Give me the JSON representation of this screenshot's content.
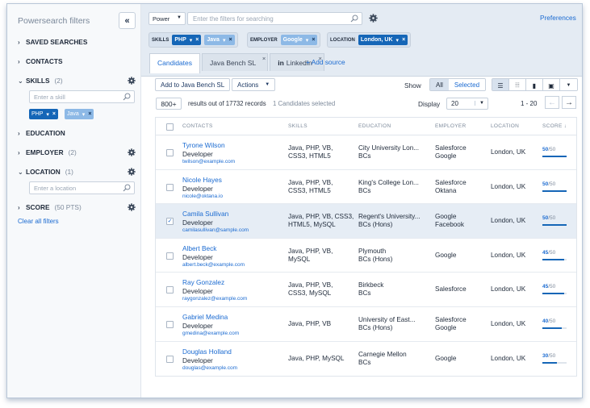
{
  "sidebar": {
    "title": "Powersearch filters",
    "collapse_icon": "«",
    "sections": [
      {
        "label": "SAVED SEARCHES",
        "count": ""
      },
      {
        "label": "CONTACTS",
        "count": ""
      },
      {
        "label": "SKILLS",
        "count": "(2)"
      },
      {
        "label": "EDUCATION",
        "count": ""
      },
      {
        "label": "EMPLOYER",
        "count": "(2)"
      },
      {
        "label": "LOCATION",
        "count": "(1)"
      },
      {
        "label": "SCORE",
        "count": "(50 PTS)"
      }
    ],
    "skill_placeholder": "Enter a skill",
    "skill_tags": [
      "PHP",
      "Java"
    ],
    "location_placeholder": "Enter a location",
    "clear_all": "Clear all filters"
  },
  "topbar": {
    "mode": "Power",
    "search_placeholder": "Enter the filters for searching",
    "preferences": "Preferences",
    "chips": [
      {
        "label": "SKILLS",
        "tags": [
          "PHP",
          "Java"
        ]
      },
      {
        "label": "EMPLOYER",
        "tags": [
          "Google"
        ]
      },
      {
        "label": "LOCATION",
        "tags": [
          "London, UK"
        ]
      }
    ],
    "tabs": [
      "Candidates",
      "Java Bench SL",
      "LinkedIn"
    ],
    "tab_close": "×",
    "add_source": "+ Add source"
  },
  "toolbar": {
    "add_to_bench": "Add to Java Bench SL",
    "actions": "Actions",
    "show_label": "Show",
    "show_all": "All",
    "show_selected": "Selected",
    "total_count": "800+",
    "results_text": "results out of 17732 records",
    "selected_text": "1 Candidates selected",
    "display_label": "Display",
    "display_value": "20",
    "page_range": "1 - 20"
  },
  "table": {
    "headers": [
      "CONTACTS",
      "SKILLS",
      "EDUCATION",
      "EMPLOYER",
      "LOCATION",
      "SCORE ↓"
    ],
    "rows": [
      {
        "name": "Tyrone Wilson",
        "title": "Developer",
        "email": "twilson@example.com",
        "skills1": "Java, PHP, VB,",
        "skills2": "CSS3, HTML5",
        "edu1": "City University Lon...",
        "edu2": "BCs",
        "emp1": "Salesforce",
        "emp2": "Google",
        "location": "London, UK",
        "score": "50",
        "score_max": "/50",
        "checked": false
      },
      {
        "name": "Nicole Hayes",
        "title": "Developer",
        "email": "nicole@oktana.io",
        "skills1": "Java, PHP, VB,",
        "skills2": "CSS3, HTML5",
        "edu1": "King's College Lon...",
        "edu2": "BCs",
        "emp1": "Salesforce",
        "emp2": "Oktana",
        "location": "London, UK",
        "score": "50",
        "score_max": "/50",
        "checked": false
      },
      {
        "name": "Camila Sullivan",
        "title": "Developer",
        "email": "camilasullivan@sample.com",
        "skills1": "Java, PHP, VB, CSS3,",
        "skills2": "HTML5, MySQL",
        "edu1": "Regent's University...",
        "edu2": "BCs (Hons)",
        "emp1": "Google",
        "emp2": "Facebook",
        "location": "London, UK",
        "score": "50",
        "score_max": "/50",
        "checked": true
      },
      {
        "name": "Albert Beck",
        "title": "Developer",
        "email": "albert.beck@example.com",
        "skills1": "Java, PHP, VB,",
        "skills2": "MySQL",
        "edu1": "Plymouth",
        "edu2": "BCs (Hons)",
        "emp1": "Google",
        "emp2": "",
        "location": "London, UK",
        "score": "45",
        "score_max": "/50",
        "checked": false
      },
      {
        "name": "Ray Gonzalez",
        "title": "Developer",
        "email": "raygonzalez@example.com",
        "skills1": "Java, PHP, VB,",
        "skills2": "CSS3, MySQL",
        "edu1": "Birkbeck",
        "edu2": "BCs",
        "emp1": "Salesforce",
        "emp2": "",
        "location": "London, UK",
        "score": "45",
        "score_max": "/50",
        "checked": false
      },
      {
        "name": "Gabriel Medina",
        "title": "Developer",
        "email": "gmedina@example.com",
        "skills1": "Java, PHP, VB",
        "skills2": "",
        "edu1": "University of East...",
        "edu2": "BCs (Hons)",
        "emp1": "Salesforce",
        "emp2": "Google",
        "location": "London, UK",
        "score": "40",
        "score_max": "/50",
        "checked": false
      },
      {
        "name": "Douglas Holland",
        "title": "Developer",
        "email": "douglas@example.com",
        "skills1": "Java, PHP, MySQL",
        "skills2": "",
        "edu1": "Carnegie Mellon",
        "edu2": "BCs",
        "emp1": "Google",
        "emp2": "",
        "location": "London, UK",
        "score": "30",
        "score_max": "/50",
        "checked": false
      }
    ]
  },
  "colors": {
    "accent": "#1a6ad1",
    "tag_dark": "#1566b7",
    "tag_light": "#8db9e6",
    "selected_row": "#e6edf5"
  }
}
